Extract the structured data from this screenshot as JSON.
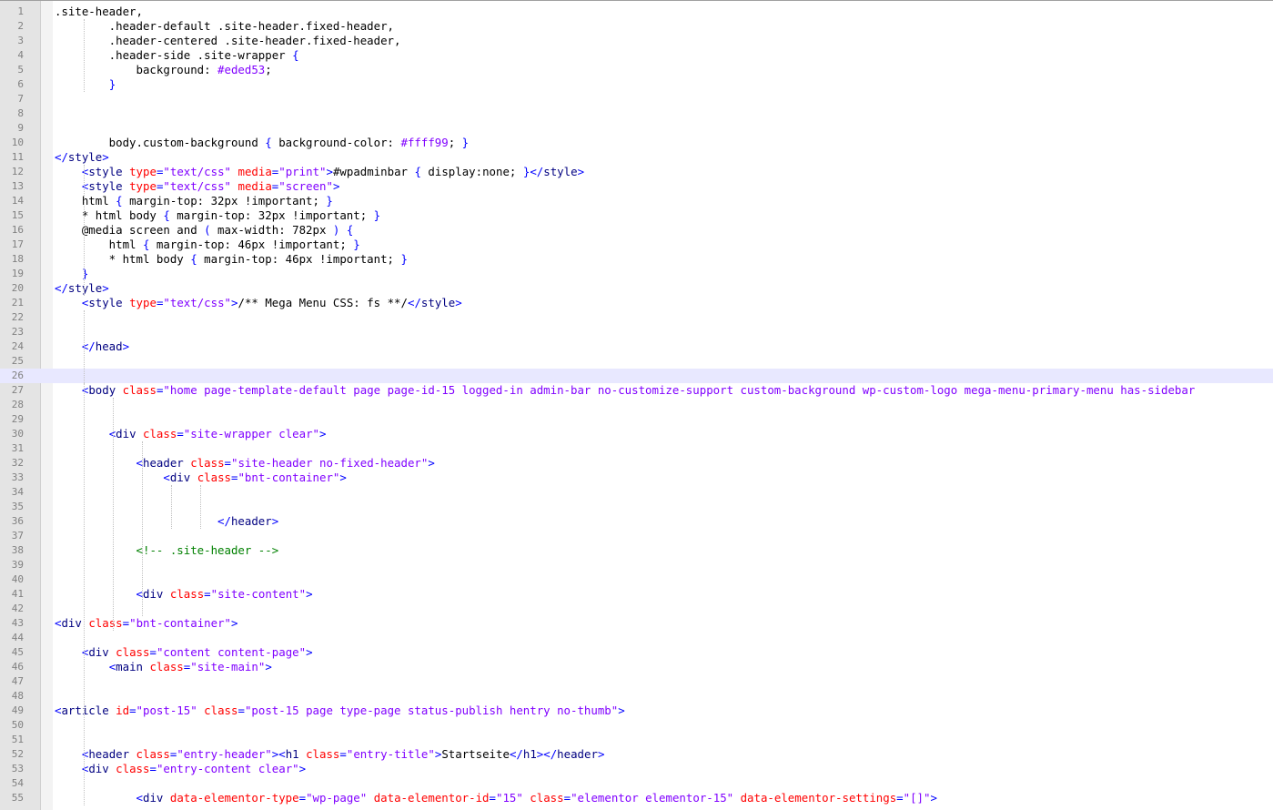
{
  "editor": {
    "lines": [
      {
        "n": "1",
        "text": ".site-header,"
      },
      {
        "n": "2",
        "text": "        .header-default .site-header.fixed-header,"
      },
      {
        "n": "3",
        "text": "        .header-centered .site-header.fixed-header,"
      },
      {
        "n": "4",
        "text": "        .header-side .site-wrapper {"
      },
      {
        "n": "5",
        "text": "            background: #eded53;"
      },
      {
        "n": "6",
        "text": "        }"
      },
      {
        "n": "7",
        "text": ""
      },
      {
        "n": "8",
        "text": ""
      },
      {
        "n": "9",
        "text": ""
      },
      {
        "n": "10",
        "text": "        body.custom-background { background-color: #ffff99; }"
      },
      {
        "n": "11",
        "text": "</style>"
      },
      {
        "n": "12",
        "text": "    <style type=\"text/css\" media=\"print\">#wpadminbar { display:none; }</style>"
      },
      {
        "n": "13",
        "text": "    <style type=\"text/css\" media=\"screen\">"
      },
      {
        "n": "14",
        "text": "    html { margin-top: 32px !important; }"
      },
      {
        "n": "15",
        "text": "    * html body { margin-top: 32px !important; }"
      },
      {
        "n": "16",
        "text": "    @media screen and ( max-width: 782px ) {"
      },
      {
        "n": "17",
        "text": "        html { margin-top: 46px !important; }"
      },
      {
        "n": "18",
        "text": "        * html body { margin-top: 46px !important; }"
      },
      {
        "n": "19",
        "text": "    }"
      },
      {
        "n": "20",
        "text": "</style>"
      },
      {
        "n": "21",
        "text": "    <style type=\"text/css\">/** Mega Menu CSS: fs **/</style>"
      },
      {
        "n": "22",
        "text": ""
      },
      {
        "n": "23",
        "text": ""
      },
      {
        "n": "24",
        "text": "    </head>"
      },
      {
        "n": "25",
        "text": ""
      },
      {
        "n": "26",
        "text": ""
      },
      {
        "n": "27",
        "text": "    <body class=\"home page-template-default page page-id-15 logged-in admin-bar no-customize-support custom-background wp-custom-logo mega-menu-primary-menu has-sidebar"
      },
      {
        "n": "28",
        "text": ""
      },
      {
        "n": "29",
        "text": ""
      },
      {
        "n": "30",
        "text": "        <div class=\"site-wrapper clear\">"
      },
      {
        "n": "31",
        "text": ""
      },
      {
        "n": "32",
        "text": "            <header class=\"site-header no-fixed-header\">"
      },
      {
        "n": "33",
        "text": "                <div class=\"bnt-container\">"
      },
      {
        "n": "34",
        "text": ""
      },
      {
        "n": "35",
        "text": ""
      },
      {
        "n": "36",
        "text": "                        </header>"
      },
      {
        "n": "37",
        "text": ""
      },
      {
        "n": "38",
        "text": "            <!-- .site-header -->"
      },
      {
        "n": "39",
        "text": ""
      },
      {
        "n": "40",
        "text": ""
      },
      {
        "n": "41",
        "text": "            <div class=\"site-content\">"
      },
      {
        "n": "42",
        "text": ""
      },
      {
        "n": "43",
        "text": "<div class=\"bnt-container\">"
      },
      {
        "n": "44",
        "text": ""
      },
      {
        "n": "45",
        "text": "    <div class=\"content content-page\">"
      },
      {
        "n": "46",
        "text": "        <main class=\"site-main\">"
      },
      {
        "n": "47",
        "text": ""
      },
      {
        "n": "48",
        "text": ""
      },
      {
        "n": "49",
        "text": "<article id=\"post-15\" class=\"post-15 page type-page status-publish hentry no-thumb\">"
      },
      {
        "n": "50",
        "text": ""
      },
      {
        "n": "51",
        "text": ""
      },
      {
        "n": "52",
        "text": "    <header class=\"entry-header\"><h1 class=\"entry-title\">Startseite</h1></header>"
      },
      {
        "n": "53",
        "text": "    <div class=\"entry-content clear\">"
      },
      {
        "n": "54",
        "text": ""
      },
      {
        "n": "55",
        "text": "            <div data-elementor-type=\"wp-page\" data-elementor-id=\"15\" class=\"elementor elementor-15\" data-elementor-settings=\"[]\">"
      }
    ],
    "current_line": "26",
    "colors": {
      "tag": "#000080",
      "bracket": "#0000ff",
      "attribute": "#ff0000",
      "value": "#8000ff",
      "comment": "#008000",
      "line_number": "#808080",
      "current_line_bg": "#e8e8ff"
    }
  }
}
